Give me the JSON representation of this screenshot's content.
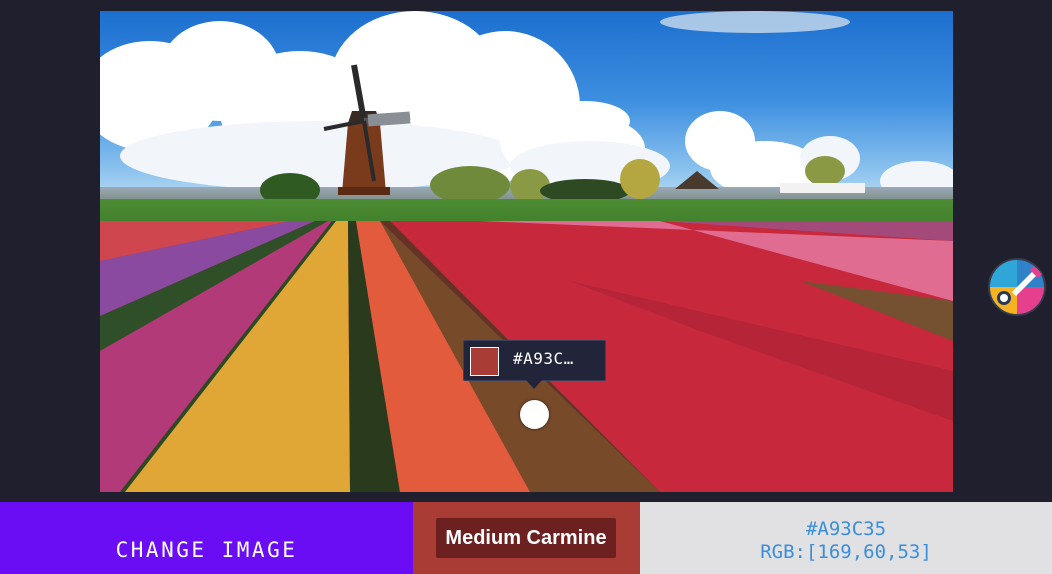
{
  "picker": {
    "hex_truncated": "#A93C…",
    "hex": "#A93C35",
    "rgb_text": "RGB:[169,60,53]",
    "color_name": "Medium Carmine",
    "swatch_color": "#A93C35"
  },
  "actions": {
    "change_image_label": "CHANGE IMAGE"
  },
  "icons": {
    "palette": "palette-icon"
  },
  "colors": {
    "change_button_bg": "#6a0df4",
    "name_panel_bg": "#A93C35",
    "code_panel_bg": "#e1e1e4",
    "code_text": "#3a8fd8"
  }
}
